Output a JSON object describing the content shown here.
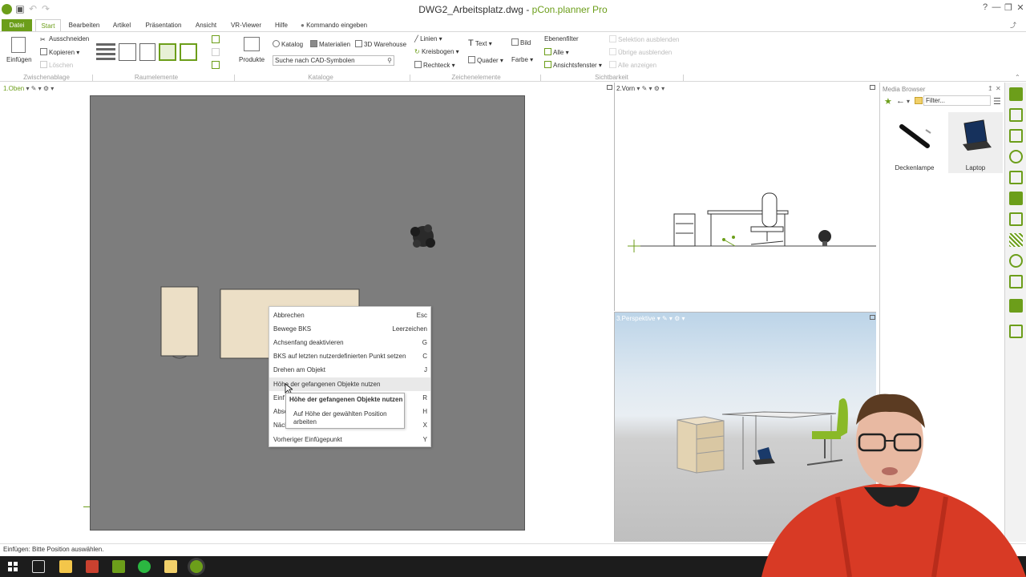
{
  "window": {
    "title_file": "DWG2_Arbeitsplatz.dwg",
    "title_sep": " - ",
    "title_app": "pCon.planner Pro",
    "help_glyph": "?",
    "minimize_glyph": "—",
    "restore_glyph": "❐",
    "close_glyph": "✕",
    "undo_glyph": "↶",
    "redo_glyph": "↷",
    "share_glyph": "⤴",
    "collapse_glyph": "⌃"
  },
  "tabs": [
    "Datei",
    "Start",
    "Bearbeiten",
    "Artikel",
    "Präsentation",
    "Ansicht",
    "VR-Viewer",
    "Hilfe"
  ],
  "command_input": "Kommando eingeben",
  "ribbon": {
    "clipboard": {
      "paste": "Einfügen",
      "cut": "Ausschneiden",
      "copy": "Kopieren",
      "delete": "Löschen",
      "group": "Zwischenablage"
    },
    "room": {
      "group": "Raumelemente"
    },
    "catalog": {
      "products": "Produkte",
      "catalog": "Katalog",
      "materials": "Materialien",
      "warehouse": "3D Warehouse",
      "search_placeholder": "Suche nach CAD-Symbolen",
      "group": "Kataloge"
    },
    "draw": {
      "lines": "Linien",
      "arc": "Kreisbogen",
      "rect": "Rechteck",
      "text": "Text",
      "image": "Bild",
      "box": "Quader",
      "color": "Farbe",
      "group": "Zeichenelemente"
    },
    "visibility": {
      "layer_filter": "Ebenenfilter",
      "all": "Alle",
      "view_window": "Ansichtsfenster",
      "hide_selection": "Selektion ausblenden",
      "hide_others": "Übrige ausblenden",
      "show_all": "Alle anzeigen",
      "group": "Sichtbarkeit"
    }
  },
  "viewports": {
    "top": {
      "label": "1.Oben"
    },
    "front": {
      "label": "2.Vorn"
    },
    "perspective": {
      "label": "3.Perspektive"
    }
  },
  "context_menu": {
    "items": [
      {
        "label": "Abbrechen",
        "shortcut": "Esc"
      },
      {
        "label": "Bewege BKS",
        "shortcut": "Leerzeichen"
      },
      {
        "label": "Achsenfang deaktivieren",
        "shortcut": "G"
      },
      {
        "label": "BKS auf letzten nutzerdefinierten Punkt setzen",
        "shortcut": "C"
      },
      {
        "label": "Drehen am Objekt",
        "shortcut": "J"
      },
      {
        "label": "Höhe der gefangenen Objekte nutzen",
        "shortcut": ""
      },
      {
        "label": "Einf",
        "shortcut": "R"
      },
      {
        "label": "Absc",
        "shortcut": "H"
      },
      {
        "label": "Näch",
        "shortcut": "X"
      },
      {
        "label": "Vorheriger Einfügepunkt",
        "shortcut": "Y"
      }
    ],
    "highlighted_index": 5
  },
  "tooltip": {
    "title": "Höhe der gefangenen Objekte nutzen",
    "body": "Auf Höhe der gewählten Position arbeiten"
  },
  "media_browser": {
    "title": "Media Browser",
    "pin_glyph": "↥",
    "close_glyph": "✕",
    "filter_placeholder": "Filter...",
    "items": [
      {
        "name": "Deckenlampe"
      },
      {
        "name": "Laptop"
      }
    ]
  },
  "status": "Einfügen: Bitte Position auswählen.",
  "colors": {
    "accent": "#6c9e1a",
    "canvas": "#7d7d7d",
    "furniture": "#ecdfc6",
    "taskbar": "#1c1c1c"
  }
}
